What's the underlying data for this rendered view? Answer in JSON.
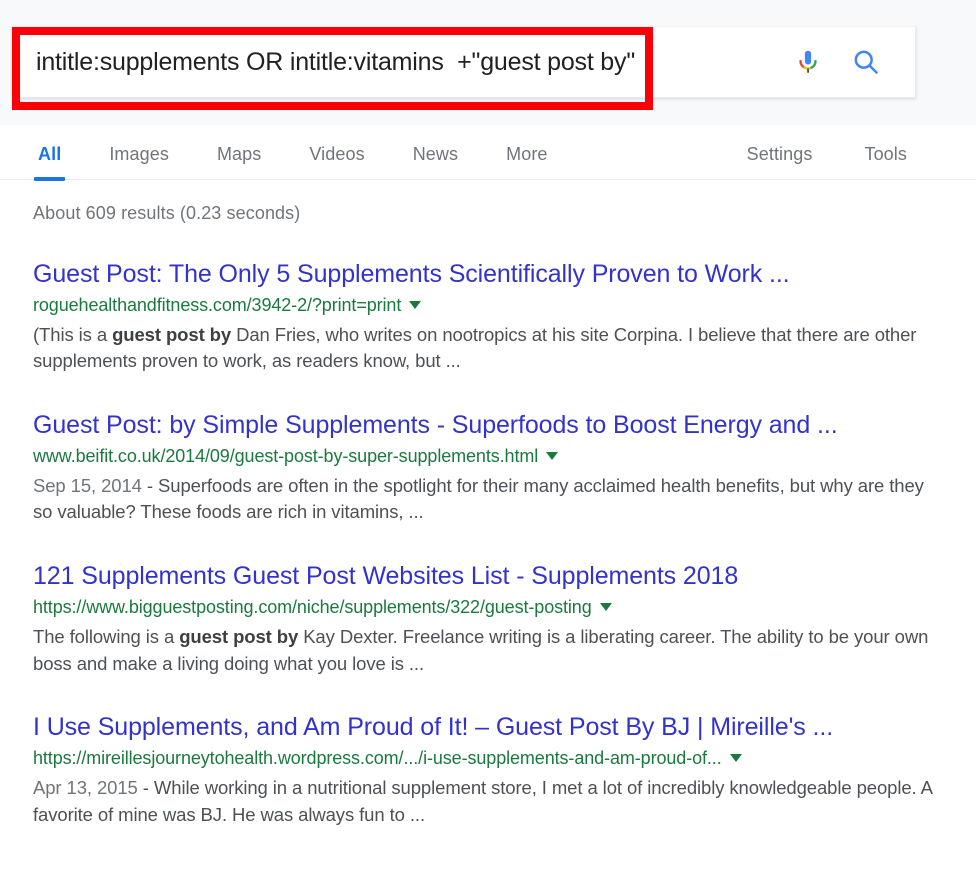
{
  "search": {
    "query": "intitle:supplements OR intitle:vitamins  +\"guest post by\"",
    "placeholder": "Search",
    "mic_icon": "microphone-icon",
    "search_icon": "search-magnifier-icon"
  },
  "annotation": {
    "color": "#fb0007",
    "shape": "rectangle-highlight"
  },
  "nav": {
    "tabs": [
      {
        "label": "All",
        "active": true
      },
      {
        "label": "Images",
        "active": false
      },
      {
        "label": "Maps",
        "active": false
      },
      {
        "label": "Videos",
        "active": false
      },
      {
        "label": "News",
        "active": false
      },
      {
        "label": "More",
        "active": false
      }
    ],
    "right": [
      {
        "label": "Settings"
      },
      {
        "label": "Tools"
      }
    ],
    "active_color": "#1a73e8"
  },
  "results_meta": {
    "stats": "About 609 results (0.23 seconds)"
  },
  "results": [
    {
      "title": "Guest Post: The Only 5 Supplements Scientifically Proven to Work ...",
      "url": "roguehealthandfitness.com/3942-2/?print=print",
      "date": "",
      "snippet_pre": "(This is a ",
      "snippet_bold": "guest post by",
      "snippet_post": " Dan Fries, who writes on nootropics at his site Corpina. I believe that there are other supplements proven to work, as readers know, but ..."
    },
    {
      "title": "Guest Post: by Simple Supplements - Superfoods to Boost Energy and ...",
      "url": "www.beifit.co.uk/2014/09/guest-post-by-super-supplements.html",
      "date": "Sep 15, 2014",
      "snippet_pre": " - Superfoods are often in the spotlight for their many acclaimed health benefits, but why are they so valuable? These foods are rich in vitamins, ...",
      "snippet_bold": "",
      "snippet_post": ""
    },
    {
      "title": "121 Supplements Guest Post Websites List - Supplements 2018",
      "url": "https://www.bigguestposting.com/niche/supplements/322/guest-posting",
      "date": "",
      "snippet_pre": "The following is a ",
      "snippet_bold": "guest post by",
      "snippet_post": " Kay Dexter. Freelance writing is a liberating career. The ability to be your own boss and make a living doing what you love is ..."
    },
    {
      "title": "I Use Supplements, and Am Proud of It! – Guest Post By BJ | Mireille's ...",
      "url": "https://mireillesjourneytohealth.wordpress.com/.../i-use-supplements-and-am-proud-of...",
      "date": "Apr 13, 2015",
      "snippet_pre": " - While working in a nutritional supplement store, I met a lot of incredibly knowledgeable people. A favorite of mine was BJ. He was always fun to ...",
      "snippet_bold": "",
      "snippet_post": ""
    }
  ],
  "colors": {
    "title_link": "#3333cc",
    "url_green": "#1a7a3e",
    "snippet": "#4d5156",
    "muted": "#70757a"
  }
}
